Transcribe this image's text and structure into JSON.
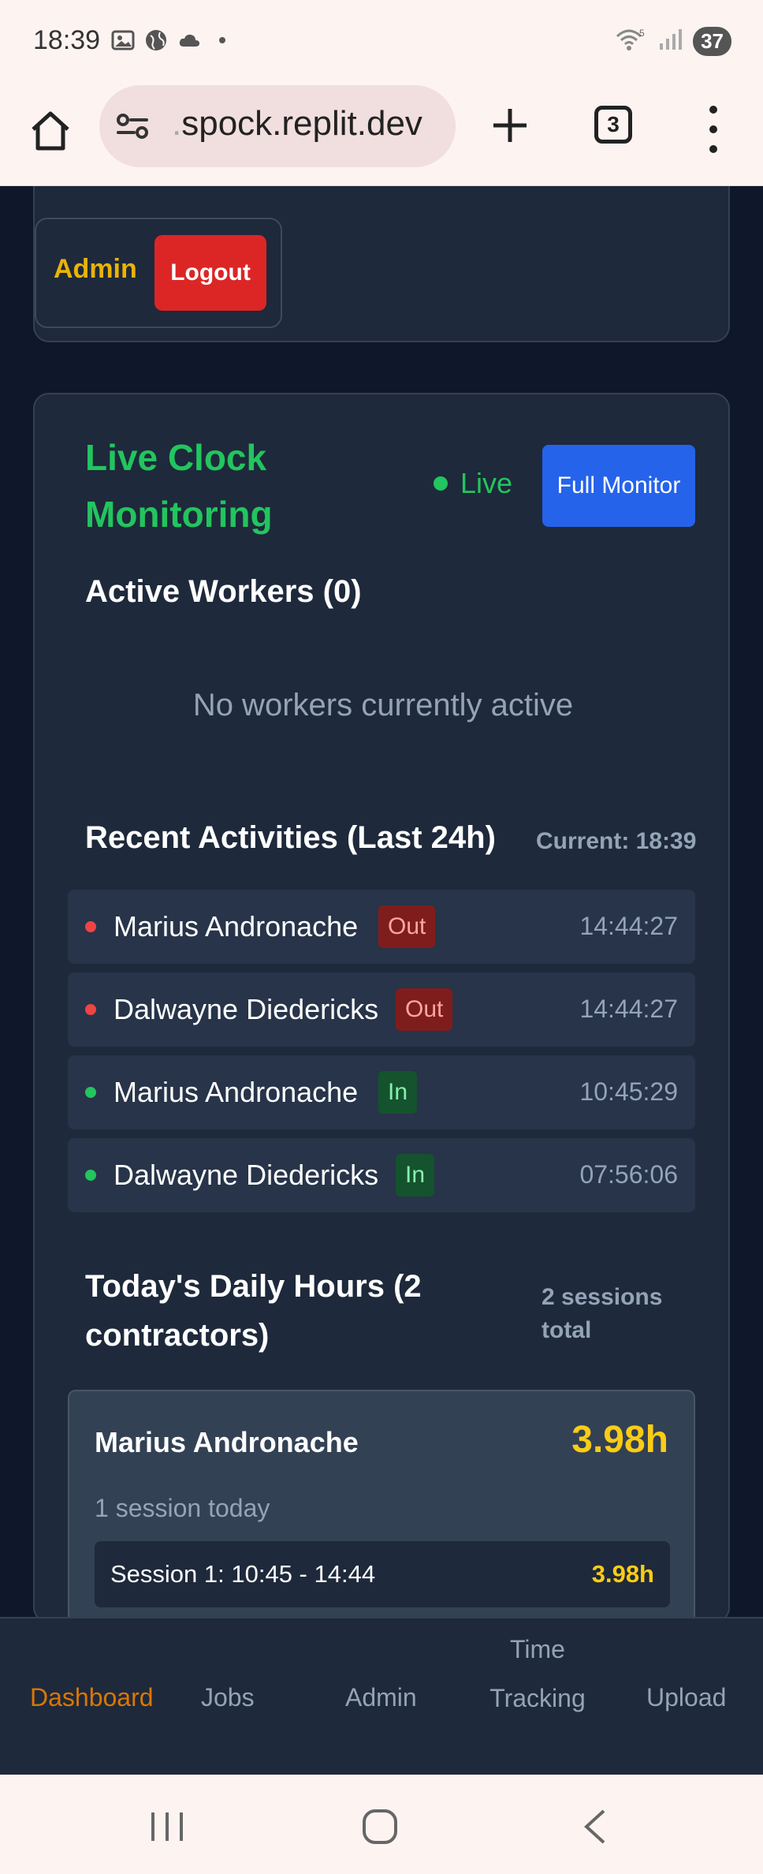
{
  "status_bar": {
    "time": "18:39",
    "battery": "37",
    "wifi_label": "5"
  },
  "browser": {
    "url_faded": ".",
    "url": "spock.replit.dev",
    "tab_count": "3"
  },
  "header": {
    "user_role": "Admin",
    "logout_label": "Logout"
  },
  "live_monitor": {
    "title": "Live Clock Monitoring",
    "status": "Live",
    "full_monitor_label": "Full Monitor",
    "active_workers_heading": "Active Workers (0)",
    "empty_text": "No workers currently active",
    "recent_heading": "Recent Activities (Last 24h)",
    "current_time": "Current: 18:39",
    "activities": [
      {
        "name": "Marius Andronache",
        "status": "Out",
        "time": "14:44:27"
      },
      {
        "name": "Dalwayne Diedericks",
        "status": "Out",
        "time": "14:44:27"
      },
      {
        "name": "Marius Andronache",
        "status": "In",
        "time": "10:45:29"
      },
      {
        "name": "Dalwayne Diedericks",
        "status": "In",
        "time": "07:56:06"
      }
    ],
    "daily_heading": "Today's Daily Hours (2 contractors)",
    "sessions_total": "2 sessions total",
    "contractors": [
      {
        "name": "Marius Andronache",
        "hours": "3.98h",
        "subtitle": "1 session today",
        "sessions": [
          {
            "label": "Session 1: 10:45 - 14:44",
            "hours": "3.98h"
          }
        ]
      }
    ]
  },
  "colors": {
    "accent_green": "#22c55e",
    "accent_yellow": "#facc15",
    "danger": "#dc2626",
    "primary": "#2563eb",
    "nav_active": "#d97706"
  },
  "bottom_nav": {
    "items": [
      {
        "label": "Dashboard",
        "active": true
      },
      {
        "label": "Jobs"
      },
      {
        "label": "Admin"
      },
      {
        "label": "Time Tracking"
      },
      {
        "label": "Upload"
      }
    ]
  }
}
